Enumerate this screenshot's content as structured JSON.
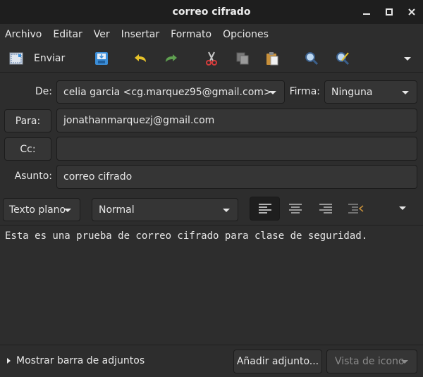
{
  "window": {
    "title": "correo cifrado"
  },
  "menubar": {
    "items": [
      "Archivo",
      "Editar",
      "Ver",
      "Insertar",
      "Formato",
      "Opciones"
    ]
  },
  "toolbar": {
    "send_label": "Enviar"
  },
  "header": {
    "from_label": "De:",
    "from_value": "celia garcia <cg.marquez95@gmail.com>",
    "signature_label": "Firma:",
    "signature_value": "Ninguna",
    "to_button": "Para:",
    "to_value": "jonathanmarquezj@gmail.com",
    "cc_button": "Cc:",
    "cc_value": "",
    "subject_label": "Asunto:",
    "subject_value": "correo cifrado"
  },
  "format": {
    "mode": "Texto plano",
    "paragraph_style": "Normal"
  },
  "body": {
    "text": "Esta es una prueba de correo cifrado para clase de seguridad."
  },
  "attachments": {
    "toggle_label": "Mostrar barra de adjuntos",
    "add_button": "Añadir adjunto...",
    "view_button": "Vista de icono"
  },
  "colors": {
    "undo_yellow": "#e6c229",
    "redo_green": "#5fa050",
    "accent_blue": "#3b8ed8",
    "scissors_red": "#d23b3b"
  }
}
